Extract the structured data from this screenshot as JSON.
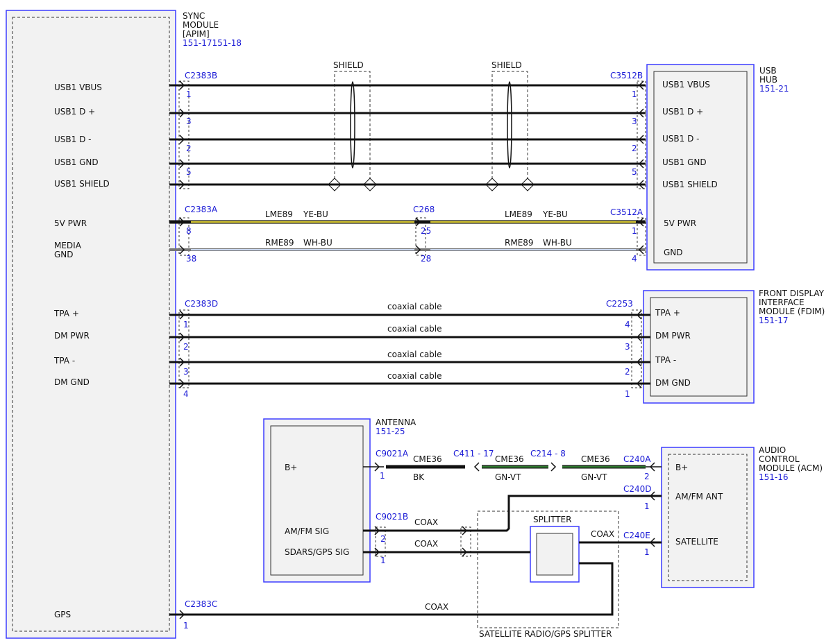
{
  "colors": {
    "module_border": "#3d3dff",
    "wire": "#111111",
    "connector_label": "#1a1ad6",
    "wire_ye_bu": "#d6c836",
    "wire_wh_bu": "#9fb6e0",
    "wire_gn_vt": "#2f7a2f",
    "module_fill": "#f2f2f2"
  },
  "modules": {
    "sync": {
      "lines": [
        "SYNC",
        "MODULE",
        "[APIM]"
      ],
      "ref": "151-17151-18"
    },
    "usb_hub": {
      "lines": [
        "USB",
        "HUB"
      ],
      "ref": "151-21"
    },
    "fdim": {
      "lines": [
        "FRONT DISPLAY",
        "INTERFACE",
        "MODULE (FDIM)"
      ],
      "ref": "151-17"
    },
    "antenna": {
      "lines": [
        "ANTENNA"
      ],
      "ref": "151-25"
    },
    "acm": {
      "lines": [
        "AUDIO",
        "CONTROL",
        "MODULE (ACM)"
      ],
      "ref": "151-16"
    },
    "splitter": {
      "label": "SPLITTER",
      "footer": "SATELLITE RADIO/GPS SPLITTER"
    }
  },
  "sync_pins": [
    "USB1 VBUS",
    "USB1 D +",
    "USB1 D -",
    "USB1 GND",
    "USB1 SHIELD",
    "5V PWR",
    "MEDIA",
    "GND",
    "TPA +",
    "DM PWR",
    "TPA -",
    "DM GND",
    "GPS"
  ],
  "usb_hub_pins": [
    "USB1 VBUS",
    "USB1 D +",
    "USB1 D -",
    "USB1 GND",
    "USB1 SHIELD",
    "5V PWR",
    "GND"
  ],
  "fdim_pins": [
    "TPA +",
    "DM PWR",
    "TPA -",
    "DM GND"
  ],
  "antenna_pins": [
    "B+",
    "AM/FM SIG",
    "SDARS/GPS SIG"
  ],
  "acm_pins": [
    "B+",
    "AM/FM ANT",
    "SATELLITE"
  ],
  "connectors": {
    "c2383b": "C2383B",
    "c3512b": "C3512B",
    "c2383a": "C2383A",
    "c268": "C268",
    "c3512a": "C3512A",
    "c2383d": "C2383D",
    "c2253": "C2253",
    "c9021a": "C9021A",
    "c411": "C411 - 17",
    "c214": "C214 - 8",
    "c240a": "C240A",
    "c240d": "C240D",
    "c9021b": "C9021B",
    "c240e": "C240E",
    "c2383c": "C2383C"
  },
  "pin_numbers": {
    "usb_left": [
      "1",
      "3",
      "2",
      "5"
    ],
    "usb_right": [
      "1",
      "3",
      "2",
      "5"
    ],
    "pwr_left": [
      "8",
      "38"
    ],
    "pwr_mid": [
      "25",
      "28"
    ],
    "pwr_right": [
      "1",
      "4"
    ],
    "coax_left": [
      "1",
      "2",
      "3",
      "4"
    ],
    "coax_right": [
      "4",
      "3",
      "2",
      "1"
    ],
    "ant_a": "1",
    "acm_b_plus": "2",
    "acm_amfm": "1",
    "ant_b": [
      "2",
      "1"
    ],
    "acm_sat": "1",
    "gps": "1"
  },
  "wire_labels": {
    "shield": "SHIELD",
    "lme89": "LME89",
    "ye_bu": "YE-BU",
    "rme89": "RME89",
    "wh_bu": "WH-BU",
    "coaxial_cable": "coaxial cable",
    "cme36": "CME36",
    "bk": "BK",
    "gn_vt": "GN-VT",
    "coax": "COAX"
  }
}
